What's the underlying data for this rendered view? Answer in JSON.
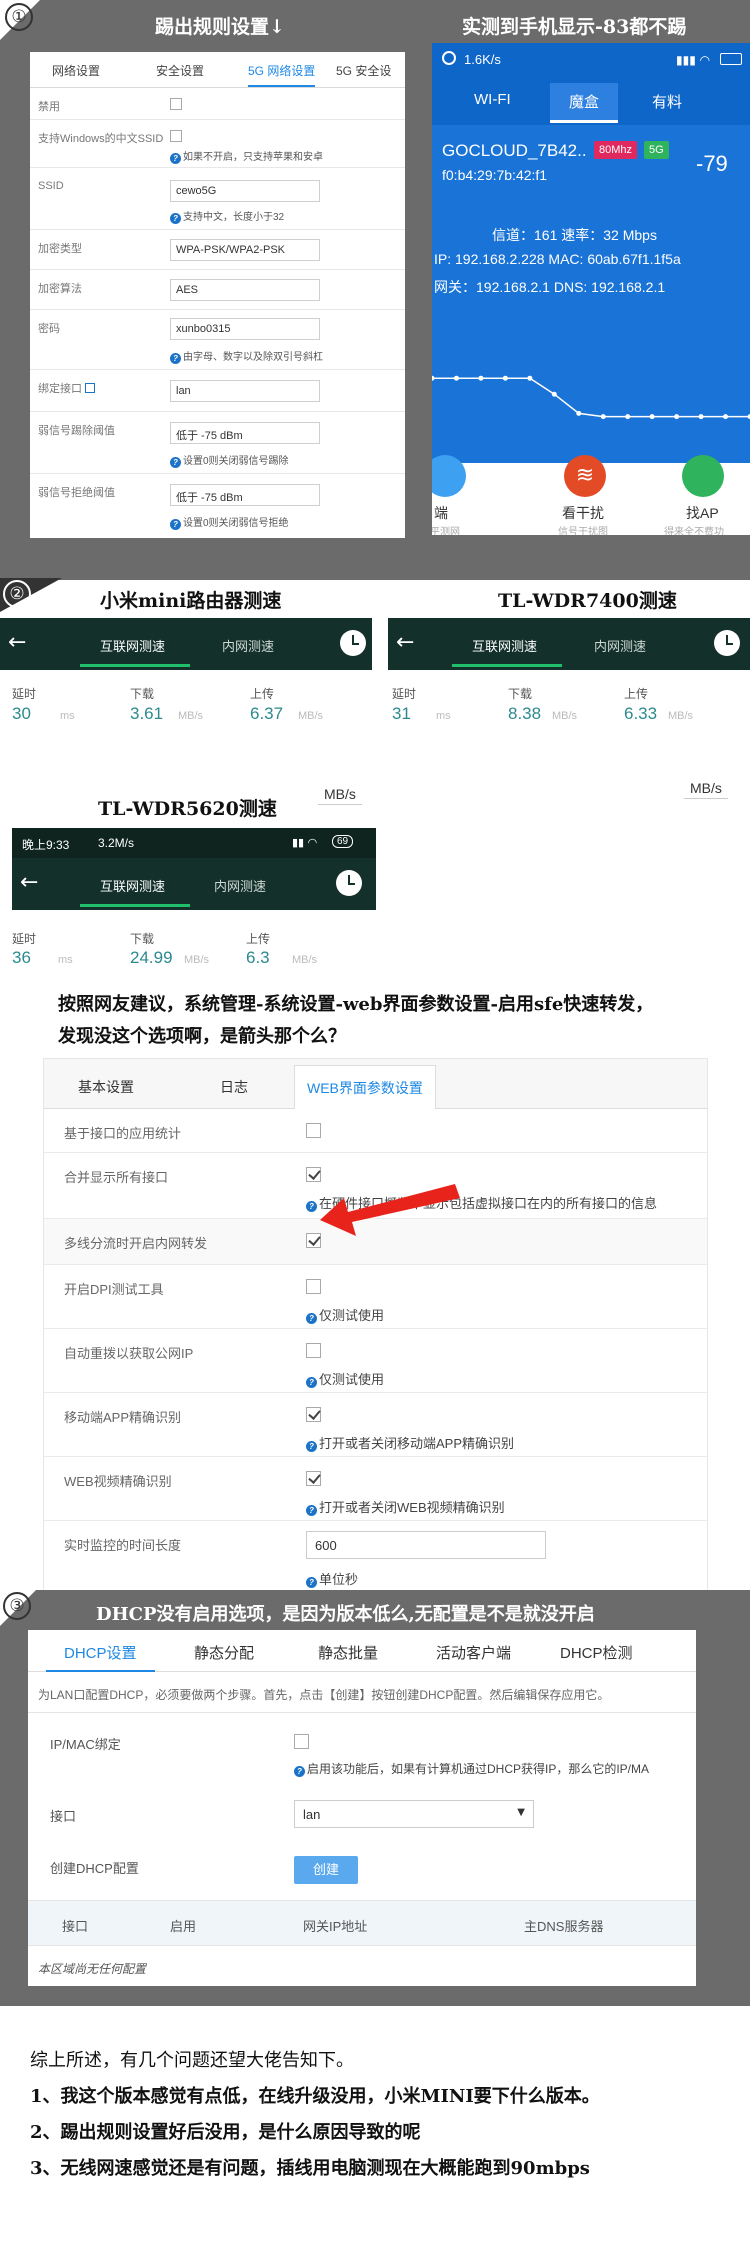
{
  "section1": {
    "number": "①",
    "title_left": "踢出规则设置↓",
    "title_right": "实测到手机显示-83都不踢",
    "router_tabs": [
      "网络设置",
      "安全设置",
      "5G 网络设置",
      "5G 安全设"
    ],
    "rows": [
      {
        "label": "禁用"
      },
      {
        "label": "支持Windows的中文SSID",
        "hint": "如果不开启，只支持苹果和安卓"
      },
      {
        "label": "SSID",
        "value": "cewo5G",
        "hint": "支持中文，长度小于32"
      },
      {
        "label": "加密类型",
        "value": "WPA-PSK/WPA2-PSK"
      },
      {
        "label": "加密算法",
        "value": "AES"
      },
      {
        "label": "密码",
        "value": "xunbo0315",
        "hint": "由字母、数字以及除双引号斜杠"
      },
      {
        "label": "绑定接口",
        "value": "lan"
      },
      {
        "label": "弱信号踢除阈值",
        "value": "低于 -75 dBm",
        "hint": "设置0则关闭弱信号踢除"
      },
      {
        "label": "弱信号拒绝阈值",
        "value": "低于 -75 dBm",
        "hint": "设置0则关闭弱信号拒绝"
      }
    ],
    "phone": {
      "speed": "1.6K/s",
      "tabs": [
        "WI-FI",
        "魔盒",
        "有料"
      ],
      "ssid": "GOCLOUD_7B42..",
      "badge_mhz": "80Mhz",
      "badge_band": "5G",
      "rssi": "-79",
      "bssid": "f0:b4:29:7b:42:f1",
      "channel_line": "信道：161  速率：32 Mbps",
      "ip_line": "IP: 192.168.2.228  MAC: 60ab.67f1.1f5a",
      "gw_line": "网关：192.168.2.1  DNS: 192.168.2.1",
      "chart_values": [
        51,
        51,
        51,
        51,
        51,
        56,
        62,
        63,
        63,
        63,
        63,
        63,
        63,
        63
      ],
      "bottom": [
        {
          "label": "端",
          "sub": "平测网"
        },
        {
          "label": "看干扰",
          "sub": "信号干扰图"
        },
        {
          "label": "找AP",
          "sub": "得来全不费功"
        }
      ]
    }
  },
  "section2": {
    "number": "②",
    "title_mi": "小米mini路由器测速",
    "title_7400": "TL-WDR7400测速",
    "title_5620": "TL-WDR5620测速",
    "tab_internet": "互联网测速",
    "tab_lan": "内网测速",
    "latency_label": "延时",
    "download_label": "下载",
    "upload_label": "上传",
    "ms": "ms",
    "mbs": "MB/s",
    "mi": {
      "latency": "30",
      "download": "3.61",
      "upload": "6.37"
    },
    "wdr7400": {
      "latency": "31",
      "download": "8.38",
      "upload": "6.33"
    },
    "wdr5620": {
      "latency": "36",
      "download": "24.99",
      "upload": "6.3",
      "status_time": "晚上9:33",
      "status_speed": "3.2M/s",
      "battery": "69"
    },
    "mbs_left": "MB/s",
    "mbs_right": "MB/s",
    "question_line1": "按照网友建议，系统管理-系统设置-web界面参数设置-启用sfe快速转发，",
    "question_line2": "发现没这个选项啊，是箭头那个么？",
    "web_tabs": [
      "基本设置",
      "日志",
      "WEB界面参数设置"
    ],
    "web_rows": [
      {
        "label": "基于接口的应用统计",
        "checked": false
      },
      {
        "label": "合并显示所有接口",
        "checked": true,
        "hint": "在硬件接口概览中显示包括虚拟接口在内的所有接口的信息"
      },
      {
        "label": "多线分流时开启内网转发",
        "checked": true
      },
      {
        "label": "开启DPI测试工具",
        "checked": false,
        "hint": "仅测试使用"
      },
      {
        "label": "自动重拨以获取公网IP",
        "checked": false,
        "hint": "仅测试使用"
      },
      {
        "label": "移动端APP精确识别",
        "checked": true,
        "hint": "打开或者关闭移动端APP精确识别"
      },
      {
        "label": "WEB视频精确识别",
        "checked": true,
        "hint": "打开或者关闭WEB视频精确识别"
      },
      {
        "label": "实时监控的时间长度",
        "value": "600",
        "hint": "单位秒"
      }
    ]
  },
  "section3": {
    "number": "③",
    "title": "DHCP没有启用选项，是因为版本低么,无配置是不是就没开启",
    "tabs": [
      "DHCP设置",
      "静态分配",
      "静态批量",
      "活动客户端",
      "DHCP检测"
    ],
    "notice": "为LAN口配置DHCP，必须要做两个步骤。首先，点击【创建】按钮创建DHCP配置。然后编辑保存应用它。",
    "ipmac_label": "IP/MAC绑定",
    "ipmac_hint": "启用该功能后，如果有计算机通过DHCP获得IP，那么它的IP/MA",
    "iface_label": "接口",
    "iface_value": "lan",
    "create_label": "创建DHCP配置",
    "create_button": "创建",
    "table_headers": [
      "接口",
      "启用",
      "网关IP地址",
      "主DNS服务器"
    ],
    "empty": "本区域尚无任何配置"
  },
  "conclusion": {
    "intro": "综上所述，有几个问题还望大佬告知下。",
    "items": [
      "1、我这个版本感觉有点低，在线升级没用，小米MINI要下什么版本。",
      "2、踢出规则设置好后没用，是什么原因导致的呢",
      "3、无线网速感觉还是有问题，插线用电脑测现在大概能跑到90mbps"
    ]
  }
}
